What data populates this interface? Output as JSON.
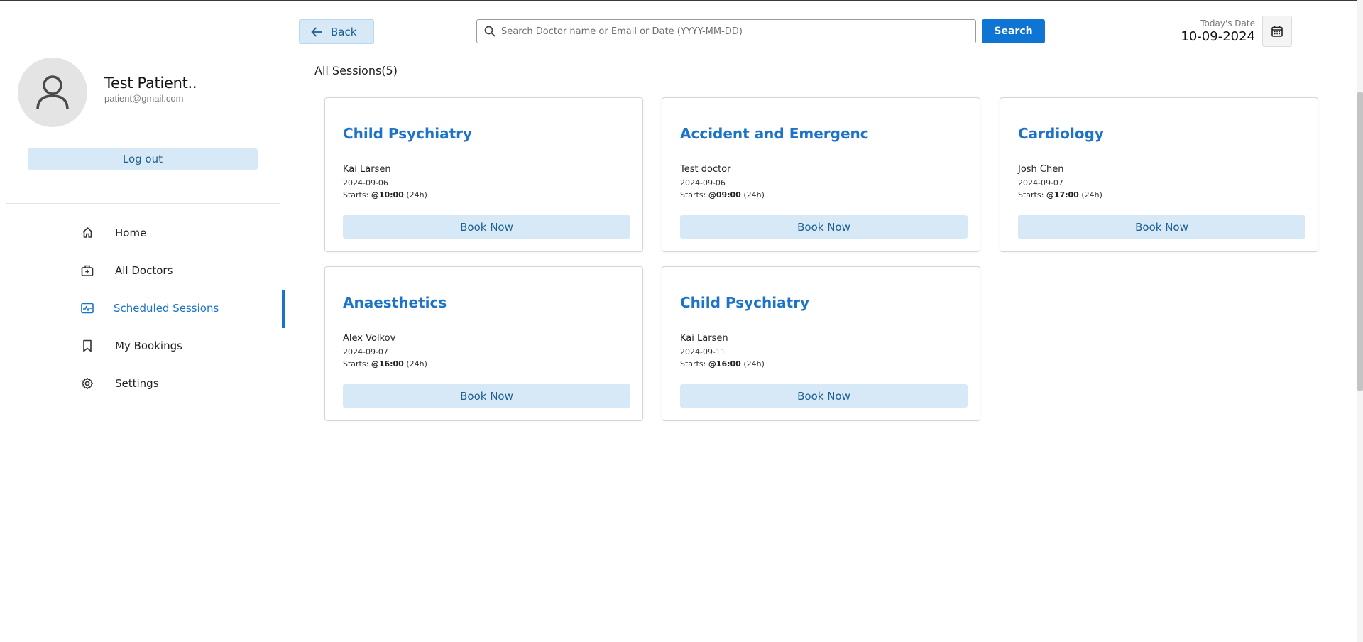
{
  "profile": {
    "name": "Test Patient..",
    "email": "patient@gmail.com",
    "logout_label": "Log out"
  },
  "nav": {
    "items": [
      {
        "label": "Home",
        "icon": "home-icon"
      },
      {
        "label": "All Doctors",
        "icon": "doctor-bag-icon"
      },
      {
        "label": "Scheduled Sessions",
        "icon": "schedule-icon",
        "active": true
      },
      {
        "label": "My Bookings",
        "icon": "bookmark-icon"
      },
      {
        "label": "Settings",
        "icon": "gear-icon"
      }
    ]
  },
  "topbar": {
    "back_label": "Back",
    "search_placeholder": "Search Doctor name or Email or Date (YYYY-MM-DD)",
    "search_label": "Search",
    "date_label": "Today's Date",
    "date_value": "10-09-2024"
  },
  "sessions": {
    "heading": "All Sessions(5)",
    "book_label": "Book Now",
    "starts_prefix": "Starts: ",
    "starts_suffix": " (24h)",
    "cards": [
      {
        "title": "Child Psychiatry",
        "doctor": "Kai Larsen",
        "date": "2024-09-06",
        "time": "@10:00"
      },
      {
        "title": "Accident and Emergenc",
        "doctor": "Test doctor",
        "date": "2024-09-06",
        "time": "@09:00"
      },
      {
        "title": "Cardiology",
        "doctor": "Josh Chen",
        "date": "2024-09-07",
        "time": "@17:00"
      },
      {
        "title": "Anaesthetics",
        "doctor": "Alex Volkov",
        "date": "2024-09-07",
        "time": "@16:00"
      },
      {
        "title": "Child Psychiatry",
        "doctor": "Kai Larsen",
        "date": "2024-09-11",
        "time": "@16:00"
      }
    ]
  },
  "colors": {
    "accent": "#1773cf",
    "button_light": "#d7e9f7",
    "title_blue": "#1c73c8"
  }
}
